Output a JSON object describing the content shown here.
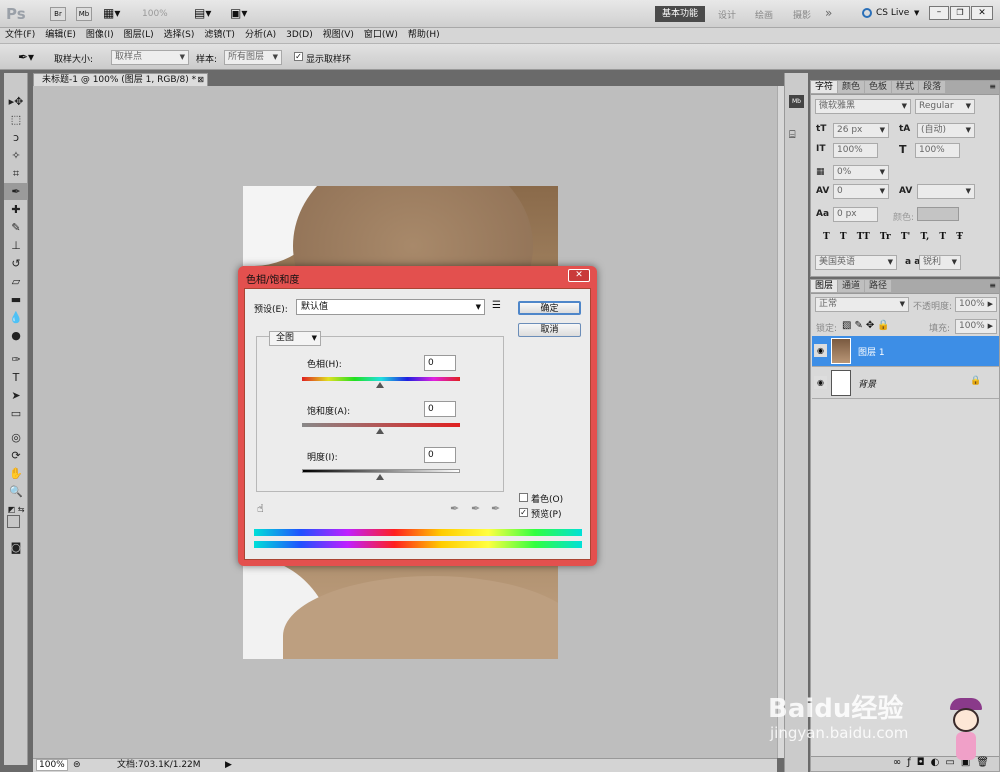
{
  "app": {
    "logo": "Ps",
    "zoom_combo": "100%",
    "workspaces": [
      "基本功能",
      "设计",
      "绘画",
      "摄影"
    ],
    "more": "»",
    "cslive": "CS Live"
  },
  "menu": [
    "文件(F)",
    "编辑(E)",
    "图像(I)",
    "图层(L)",
    "选择(S)",
    "滤镜(T)",
    "分析(A)",
    "3D(D)",
    "视图(V)",
    "窗口(W)",
    "帮助(H)"
  ],
  "options": {
    "sample_size_label": "取样大小:",
    "sample_size_value": "取样点",
    "sample_label": "样本:",
    "sample_value": "所有图层",
    "show_ring_label": "显示取样环"
  },
  "document": {
    "tab_title": "未标题-1 @ 100% (图层 1, RGB/8) *",
    "status_zoom": "100%",
    "status_doc": "文档:703.1K/1.22M"
  },
  "char_panel": {
    "tabs": [
      "字符",
      "颜色",
      "色板",
      "样式",
      "段落"
    ],
    "font_family": "微软雅黑",
    "font_style": "Regular",
    "size": "26 px",
    "leading": "(自动)",
    "vscale": "100%",
    "hscale": "100%",
    "tsume": "0%",
    "kerning": "0",
    "tracking": "",
    "baseline": "0 px",
    "color_label": "颜色:",
    "lang": "美国英语",
    "aa_label": "a a",
    "aa": "锐利",
    "styles": [
      "T",
      "T",
      "TT",
      "Tr",
      "T'",
      "T,",
      "T",
      "Ŧ"
    ]
  },
  "layers_panel": {
    "tabs": [
      "图层",
      "通道",
      "路径"
    ],
    "blend": "正常",
    "opacity_label": "不透明度:",
    "opacity": "100%",
    "lock_label": "锁定:",
    "fill_label": "填充:",
    "fill": "100%",
    "layers": [
      {
        "name": "图层 1",
        "selected": true
      },
      {
        "name": "背景",
        "selected": false
      }
    ],
    "footer_icons": [
      "link-icon",
      "fx-icon",
      "mask-icon",
      "adjustment-icon",
      "group-icon",
      "new-layer-icon",
      "trash-icon"
    ]
  },
  "dialog": {
    "title": "色相/饱和度",
    "preset_label": "预设(E):",
    "preset_value": "默认值",
    "ok": "确定",
    "cancel": "取消",
    "channel": "全图",
    "hue_label": "色相(H):",
    "hue_value": "0",
    "sat_label": "饱和度(A):",
    "sat_value": "0",
    "light_label": "明度(I):",
    "light_value": "0",
    "colorize_label": "着色(O)",
    "colorize_checked": false,
    "preview_label": "预览(P)",
    "preview_checked": true
  },
  "watermark": {
    "brand": "Baidu经验",
    "url": "jingyan.baidu.com"
  },
  "colors": {
    "dialog_frame": "#e3504e",
    "selected_layer": "#3d8ee6",
    "active_workspace": "#4a4a4a"
  }
}
